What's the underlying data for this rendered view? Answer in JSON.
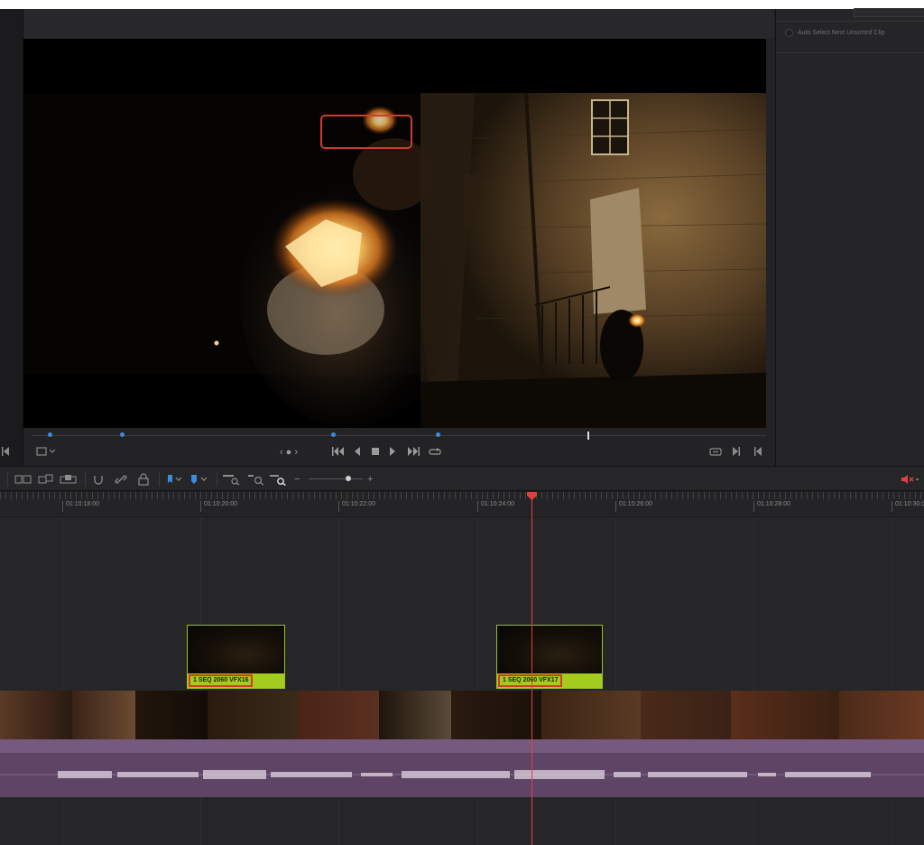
{
  "right_panel": {
    "auto_select_label": "Auto Select Next Unsorted Clip"
  },
  "viewer": {
    "scene": "night-street-torch",
    "transport": {
      "jog_glyph": "‹ ● ›"
    }
  },
  "timeline": {
    "timecodes": [
      "01:10:18:00",
      "01:10:20:00",
      "01:10:22:00",
      "01:10:24:00",
      "01:10:26:00",
      "01:10:28:00",
      "01:10:30:0"
    ],
    "vfx_clips": [
      {
        "name": "1 SEQ 2060 VFX16"
      },
      {
        "name": "1 SEQ 2060 VFX17"
      }
    ]
  },
  "colors": {
    "accent_blue": "#3b8be0",
    "playhead_red": "#e04040",
    "clip_green": "#a3cc1f",
    "audio_purple": "#6b4e72",
    "highlight_red": "#d43a2a"
  },
  "icons": {
    "toolbar": [
      "timeline-view-icon",
      "insert-icon",
      "overwrite-icon",
      "replace-icon",
      "snap-icon",
      "link-icon",
      "lock-icon",
      "flag-icon",
      "marker-icon",
      "zoom-full-icon",
      "zoom-detail-icon",
      "zoom-custom-icon",
      "zoom-out-icon",
      "zoom-in-icon",
      "mute-icon"
    ],
    "transport": [
      "go-to-start-icon",
      "prev-frame-icon",
      "stop-icon",
      "play-icon",
      "go-to-end-icon",
      "loop-icon"
    ]
  }
}
